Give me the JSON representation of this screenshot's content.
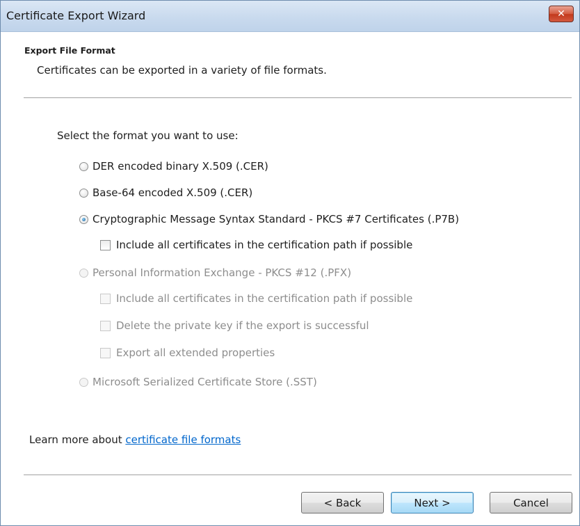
{
  "window": {
    "title": "Certificate Export Wizard",
    "close_glyph": "✕"
  },
  "header": {
    "title": "Export File Format",
    "description": "Certificates can be exported in a variety of file formats."
  },
  "format": {
    "prompt": "Select the format you want to use:",
    "options": [
      {
        "label": "DER encoded binary X.509 (.CER)",
        "selected": false,
        "enabled": true
      },
      {
        "label": "Base-64 encoded X.509 (.CER)",
        "selected": false,
        "enabled": true
      },
      {
        "label": "Cryptographic Message Syntax Standard - PKCS #7 Certificates (.P7B)",
        "selected": true,
        "enabled": true
      },
      {
        "label": "Personal Information Exchange - PKCS #12 (.PFX)",
        "selected": false,
        "enabled": false
      },
      {
        "label": "Microsoft Serialized Certificate Store (.SST)",
        "selected": false,
        "enabled": false
      }
    ],
    "p7b_options": [
      {
        "label": "Include all certificates in the certification path if possible",
        "checked": false,
        "enabled": true
      }
    ],
    "pfx_options": [
      {
        "label": "Include all certificates in the certification path if possible",
        "checked": false,
        "enabled": false
      },
      {
        "label": "Delete the private key if the export is successful",
        "checked": false,
        "enabled": false
      },
      {
        "label": "Export all extended properties",
        "checked": false,
        "enabled": false
      }
    ]
  },
  "learn_more": {
    "prefix": "Learn more about ",
    "link_text": "certificate file formats"
  },
  "buttons": {
    "back": "< Back",
    "next": "Next >",
    "cancel": "Cancel"
  }
}
